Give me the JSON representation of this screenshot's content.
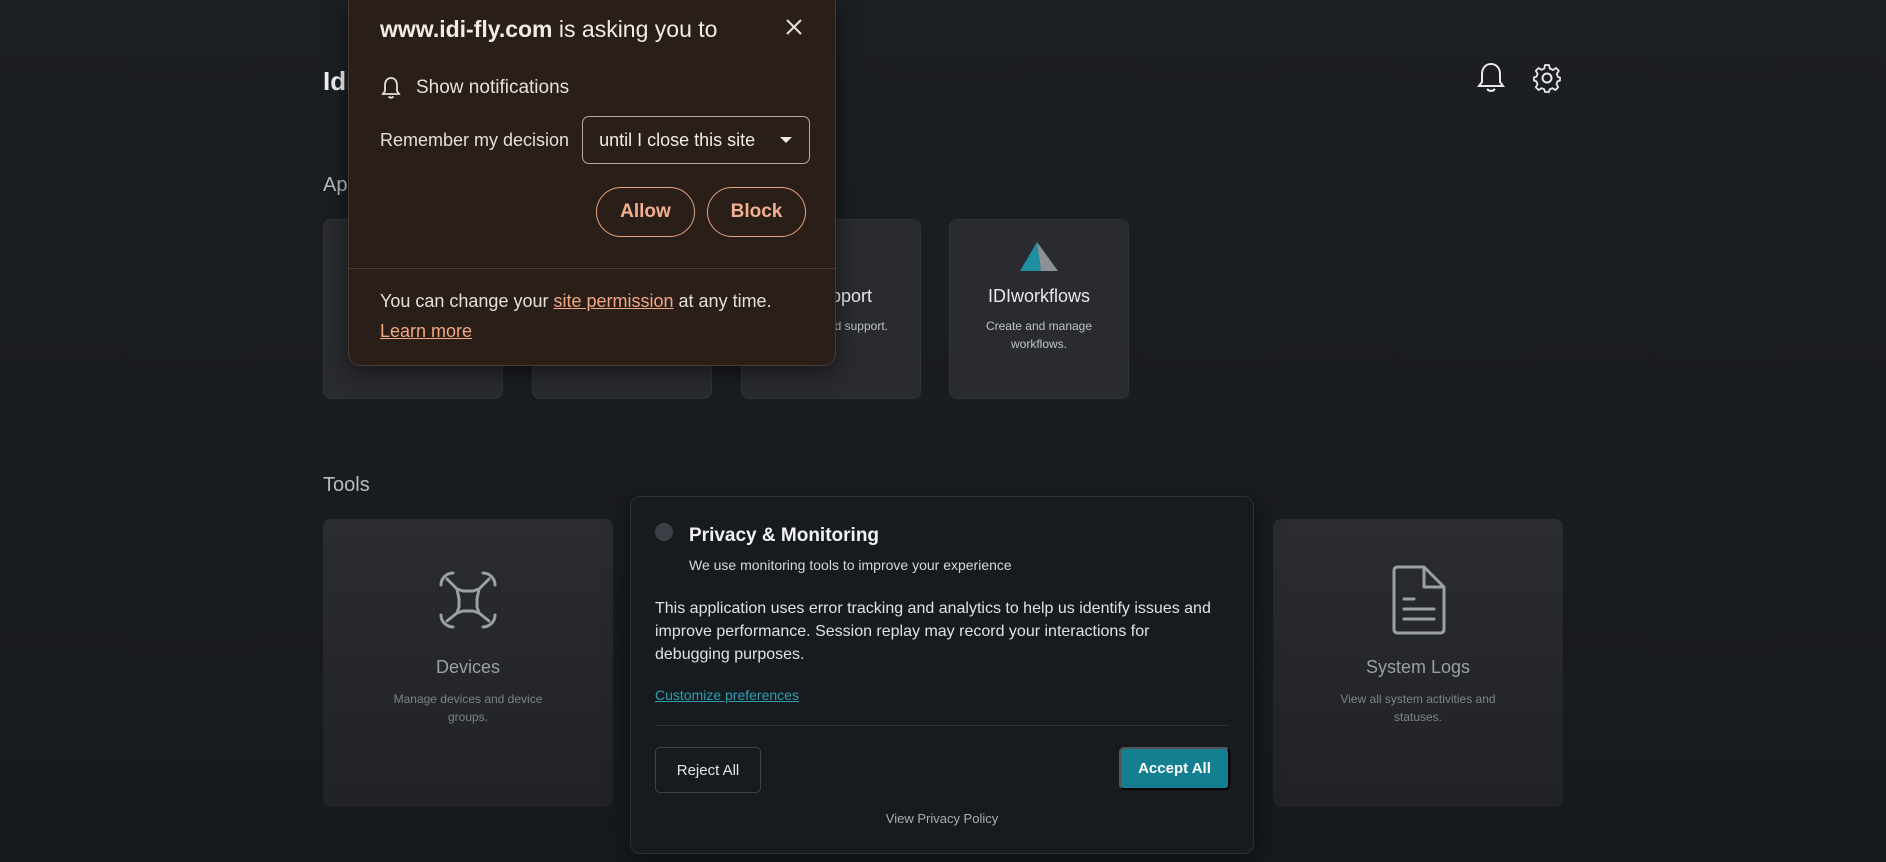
{
  "header": {
    "title": "Idi",
    "icons": [
      "bell-icon",
      "gear-icon"
    ]
  },
  "apps": {
    "section_title": "App",
    "cards": [
      {
        "name": "",
        "description": ""
      },
      {
        "name": "",
        "description": ""
      },
      {
        "name": "pport",
        "description": "d support."
      },
      {
        "name": "IDIworkflows",
        "description": "Create and manage workflows."
      }
    ]
  },
  "tools": {
    "section_title": "Tools",
    "cards": [
      {
        "name": "Devices",
        "description": "Manage devices and device groups.",
        "icon": "drone-icon"
      },
      {
        "name": "System Logs",
        "description": "View all system activities and statuses.",
        "icon": "document-icon"
      }
    ]
  },
  "permission_popup": {
    "site": "www.idi-fly.com",
    "heading_suffix": " is asking you to",
    "request": "Show notifications",
    "remember_label": "Remember my decision",
    "remember_value": "until I close this site",
    "allow_label": "Allow",
    "block_label": "Block",
    "footer_prefix": "You can change your ",
    "footer_link": "site permission",
    "footer_suffix": " at any time.",
    "learn_more": "Learn more"
  },
  "privacy": {
    "title": "Privacy & Monitoring",
    "subtitle": "We use monitoring tools to improve your experience",
    "body": "This application uses error tracking and analytics to help us identify issues and improve performance. Session replay may record your interactions for debugging purposes.",
    "customize_link": "Customize preferences",
    "reject_label": "Reject All",
    "accept_label": "Accept All",
    "policy_link": "View Privacy Policy"
  },
  "colors": {
    "background": "#1c1f24",
    "accent": "#137f91",
    "popup_bg": "#291e18",
    "popup_accent": "#f2b090"
  }
}
